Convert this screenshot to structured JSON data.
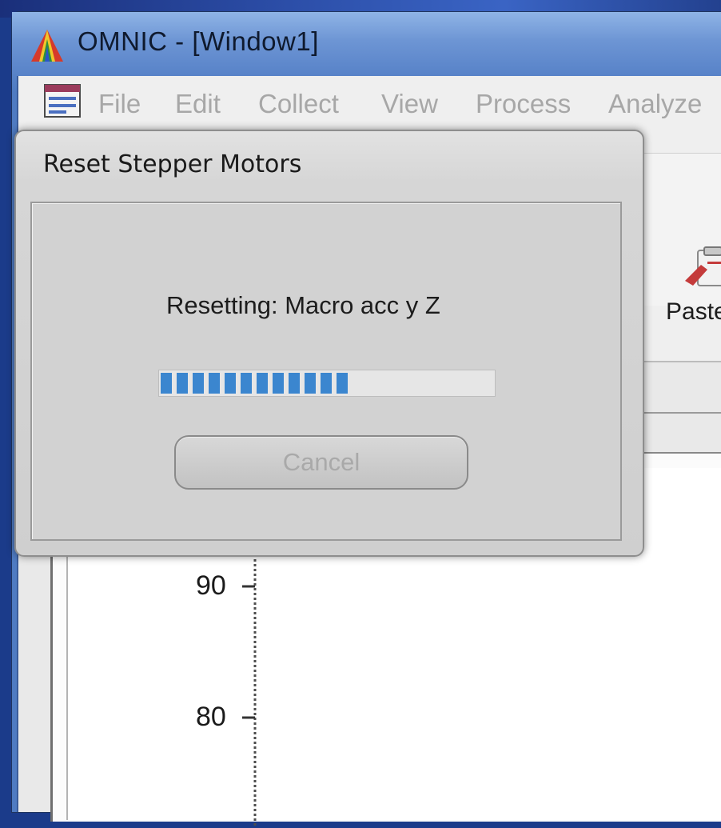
{
  "window": {
    "title": "OMNIC - [Window1]",
    "app_icon": "omnic-triangle-icon"
  },
  "menubar": {
    "icon": "document-window-icon",
    "items": [
      {
        "label": "File"
      },
      {
        "label": "Edit"
      },
      {
        "label": "Collect"
      },
      {
        "label": "View"
      },
      {
        "label": "Process"
      },
      {
        "label": "Analyze"
      }
    ]
  },
  "toolbar": {
    "paste_label": "Paste",
    "paste_icon": "paste-icon"
  },
  "plot": {
    "y_ticks": [
      "90",
      "80"
    ]
  },
  "dialog": {
    "title": "Reset Stepper Motors",
    "status": "Resetting: Macro acc y Z",
    "progress_fraction": 0.55,
    "progress_segments_filled": 12,
    "cancel_label": "Cancel"
  },
  "colors": {
    "progress_fill": "#3b86cf",
    "titlebar": "#6d95d4",
    "disabled_text": "#a9a9a9"
  }
}
